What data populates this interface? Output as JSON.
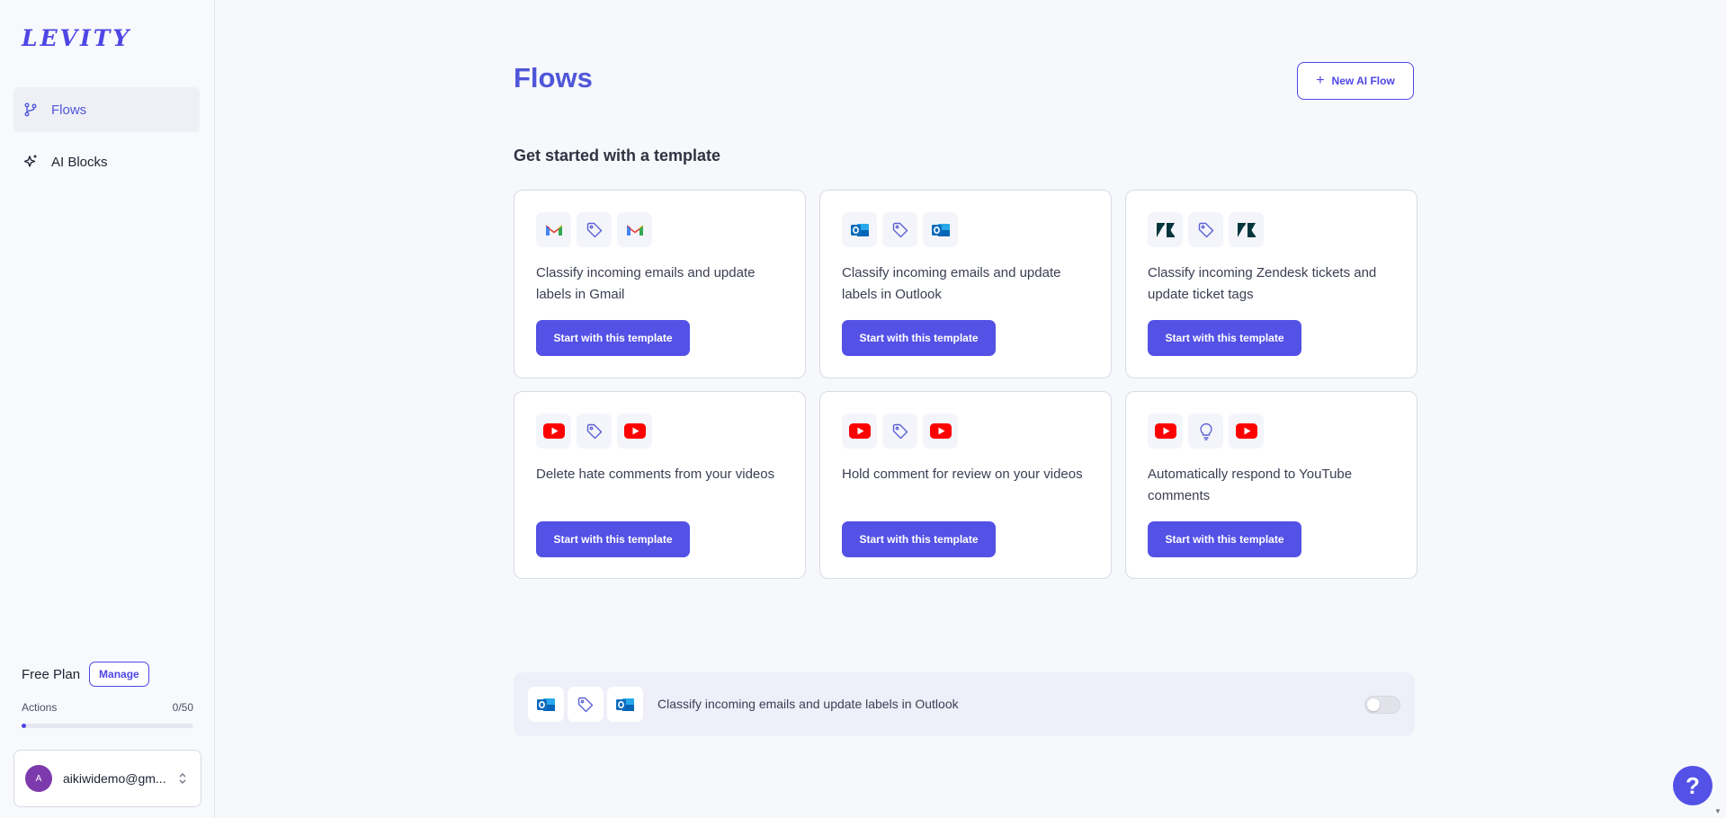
{
  "app": {
    "logo_text": "LEVITY",
    "brand_color": "#4f46e5"
  },
  "sidebar": {
    "items": [
      {
        "label": "Flows",
        "icon": "git-branch-icon",
        "active": true
      },
      {
        "label": "AI Blocks",
        "icon": "sparkles-icon",
        "active": false
      }
    ],
    "plan": {
      "name": "Free Plan",
      "manage_label": "Manage"
    },
    "actions": {
      "label": "Actions",
      "count": "0/50",
      "used": 0,
      "limit": 50
    },
    "user": {
      "avatar_letter": "A",
      "email": "aikiwidemo@gm..."
    }
  },
  "main": {
    "title": "Flows",
    "new_flow_label": "New AI Flow",
    "section_title": "Get started with a template",
    "templates": [
      {
        "description": "Classify incoming emails and update labels in Gmail",
        "icons": [
          "gmail-icon",
          "tag-icon",
          "gmail-icon"
        ],
        "button": "Start with this template"
      },
      {
        "description": "Classify incoming emails and update labels in Outlook",
        "icons": [
          "outlook-icon",
          "tag-icon",
          "outlook-icon"
        ],
        "button": "Start with this template"
      },
      {
        "description": "Classify incoming Zendesk tickets and update ticket tags",
        "icons": [
          "zendesk-icon",
          "tag-icon",
          "zendesk-icon"
        ],
        "button": "Start with this template"
      },
      {
        "description": "Delete hate comments from your videos",
        "icons": [
          "youtube-icon",
          "tag-icon",
          "youtube-icon"
        ],
        "button": "Start with this template"
      },
      {
        "description": "Hold comment for review on your videos",
        "icons": [
          "youtube-icon",
          "tag-icon",
          "youtube-icon"
        ],
        "button": "Start with this template"
      },
      {
        "description": "Automatically respond to YouTube comments",
        "icons": [
          "youtube-icon",
          "lightbulb-icon",
          "youtube-icon"
        ],
        "button": "Start with this template"
      }
    ],
    "existing_flow": {
      "label": "Classify incoming emails and update labels in Outlook",
      "icons": [
        "outlook-icon",
        "tag-icon",
        "outlook-icon"
      ],
      "enabled": false
    }
  },
  "help": {
    "label": "?"
  }
}
